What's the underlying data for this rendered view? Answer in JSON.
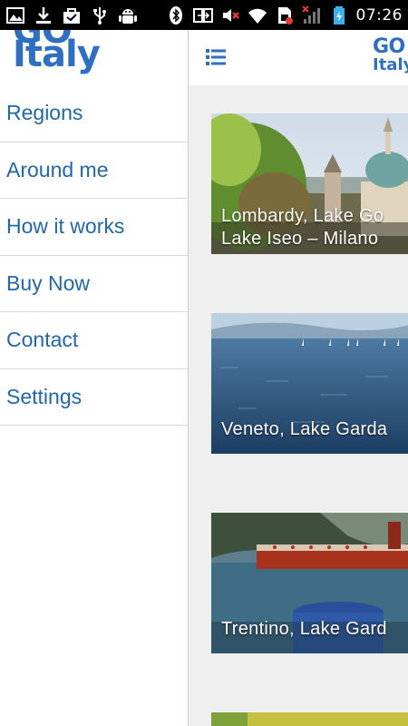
{
  "status_bar": {
    "time": "07:26",
    "left_icons": [
      "image-icon",
      "download-icon",
      "bag-icon",
      "usb-icon",
      "android-debug-icon"
    ],
    "right_icons": [
      "bluetooth-icon",
      "screen-mirror-icon",
      "mute-icon",
      "wifi-icon",
      "sim-icon",
      "signal-icon",
      "battery-icon"
    ]
  },
  "drawer": {
    "logo_top": "GO",
    "logo_bottom": "Italy",
    "items": [
      {
        "label": "Regions"
      },
      {
        "label": "Around me"
      },
      {
        "label": "How it works"
      },
      {
        "label": "Buy Now"
      },
      {
        "label": "Contact"
      },
      {
        "label": "Settings"
      }
    ]
  },
  "topbar": {
    "menu_icon": "list-menu-icon",
    "logo_line1": "GO",
    "logo_line2": "Italy"
  },
  "cards": [
    {
      "label": "Lombardy, Lake Go\nLake Iseo – Milano"
    },
    {
      "label": "Veneto, Lake Garda"
    },
    {
      "label": "Trentino, Lake Gard"
    }
  ],
  "colors": {
    "brand_blue": "#2e6fc0",
    "menu_text": "#2167ac",
    "content_bg": "#efefef"
  }
}
